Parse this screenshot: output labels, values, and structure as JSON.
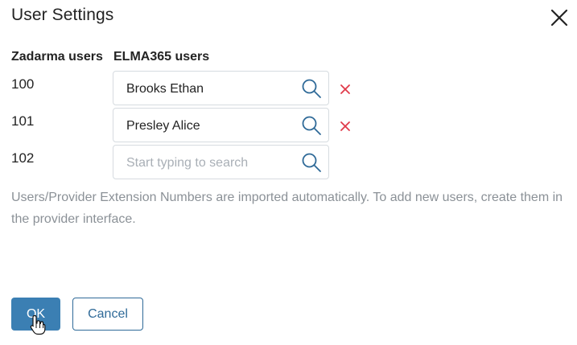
{
  "dialog": {
    "title": "User Settings"
  },
  "columns": {
    "zadarma": "Zadarma users",
    "elma": "ELMA365 users"
  },
  "rows": [
    {
      "extension": "100",
      "user": "Brooks Ethan",
      "has_user": true
    },
    {
      "extension": "101",
      "user": "Presley Alice",
      "has_user": true
    },
    {
      "extension": "102",
      "user": "",
      "has_user": false
    }
  ],
  "search": {
    "placeholder": "Start typing to search"
  },
  "note": "Users/Provider Extension Numbers are imported automatically. To add new users, create them in the provider interface.",
  "buttons": {
    "ok": "OK",
    "cancel": "Cancel"
  },
  "colors": {
    "accent": "#3b7fb3",
    "remove": "#e03a4a",
    "icon_blue": "#2f6a98"
  },
  "icons": {
    "close": "close-icon",
    "search": "search-icon",
    "remove": "remove-icon",
    "cursor": "hand-cursor-icon"
  }
}
